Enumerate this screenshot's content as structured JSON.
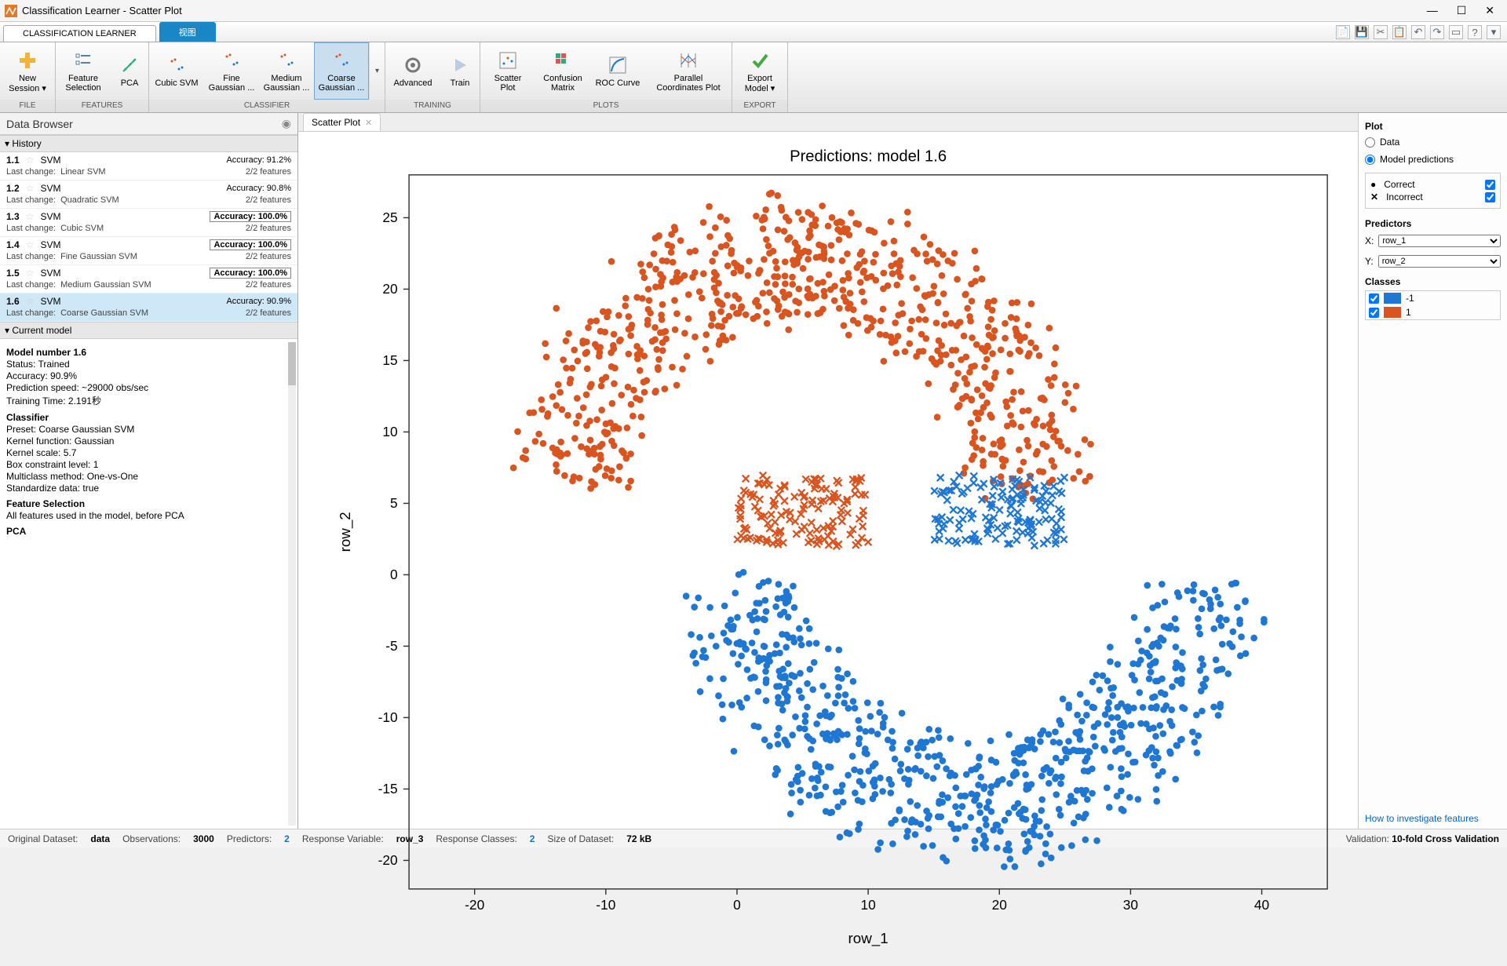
{
  "window": {
    "title": "Classification Learner - Scatter Plot"
  },
  "apptabs": {
    "main": "CLASSIFICATION LEARNER",
    "view": "视图"
  },
  "ribbon": {
    "groups": {
      "file": {
        "label": "FILE",
        "new_session": "New\nSession ▾"
      },
      "features": {
        "label": "FEATURES",
        "feature_selection": "Feature\nSelection",
        "pca": "PCA"
      },
      "classifier": {
        "label": "CLASSIFIER",
        "cubic": "Cubic SVM",
        "fine": "Fine\nGaussian ...",
        "medium": "Medium\nGaussian ...",
        "coarse": "Coarse\nGaussian ..."
      },
      "training": {
        "label": "TRAINING",
        "advanced": "Advanced",
        "train": "Train"
      },
      "plots": {
        "label": "PLOTS",
        "scatter": "Scatter\nPlot",
        "confusion": "Confusion\nMatrix",
        "roc": "ROC Curve",
        "parallel": "Parallel\nCoordinates Plot"
      },
      "export": {
        "label": "EXPORT",
        "export": "Export\nModel ▾"
      }
    }
  },
  "databrowser": {
    "title": "Data Browser",
    "history_label": "▾ History",
    "current_label": "▾ Current model",
    "items": [
      {
        "id": "1.1",
        "type": "SVM",
        "acc": "Accuracy:  91.2%",
        "boxed": false,
        "last": "Linear SVM",
        "features": "2/2 features"
      },
      {
        "id": "1.2",
        "type": "SVM",
        "acc": "Accuracy:  90.8%",
        "boxed": false,
        "last": "Quadratic SVM",
        "features": "2/2 features"
      },
      {
        "id": "1.3",
        "type": "SVM",
        "acc": "Accuracy:  100.0%",
        "boxed": true,
        "last": "Cubic SVM",
        "features": "2/2 features"
      },
      {
        "id": "1.4",
        "type": "SVM",
        "acc": "Accuracy:  100.0%",
        "boxed": true,
        "last": "Fine Gaussian SVM",
        "features": "2/2 features"
      },
      {
        "id": "1.5",
        "type": "SVM",
        "acc": "Accuracy:  100.0%",
        "boxed": true,
        "last": "Medium Gaussian SVM",
        "features": "2/2 features"
      },
      {
        "id": "1.6",
        "type": "SVM",
        "acc": "Accuracy:  90.9%",
        "boxed": false,
        "last": "Coarse Gaussian SVM",
        "features": "2/2 features"
      }
    ],
    "last_change_label": "Last change:",
    "current_model": {
      "l0": "Model number 1.6",
      "l1": "Status: Trained",
      "l2": "Accuracy: 90.9%",
      "l3": "Prediction speed: ~29000 obs/sec",
      "l4": "Training Time: 2.191秒",
      "h1": "Classifier",
      "l5": "Preset: Coarse Gaussian SVM",
      "l6": "Kernel function: Gaussian",
      "l7": "Kernel scale: 5.7",
      "l8": "Box constraint level: 1",
      "l9": "Multiclass method: One-vs-One",
      "l10": "Standardize data: true",
      "h2": "Feature Selection",
      "l11": "All features used in the model, before PCA",
      "h3": "PCA"
    }
  },
  "plot": {
    "tab": "Scatter Plot",
    "title": "Predictions: model 1.6",
    "xlabel": "row_1",
    "ylabel": "row_2"
  },
  "chart_data": {
    "type": "scatter",
    "title": "Predictions: model 1.6",
    "xlabel": "row_1",
    "ylabel": "row_2",
    "xlim": [
      -25,
      45
    ],
    "ylim": [
      -22,
      28
    ],
    "xticks": [
      -20,
      -10,
      0,
      10,
      20,
      30,
      40
    ],
    "yticks": [
      -20,
      -15,
      -10,
      -5,
      0,
      5,
      10,
      15,
      20,
      25
    ],
    "series": [
      {
        "name": "class 1 correct",
        "class": "1",
        "marker": "circle",
        "color": "#d9541e",
        "shape": "upper-arc",
        "count_approx": 900
      },
      {
        "name": "class -1 correct",
        "class": "-1",
        "marker": "circle",
        "color": "#1f77d4",
        "shape": "lower-arc",
        "count_approx": 900
      },
      {
        "name": "class 1 incorrect",
        "class": "1",
        "marker": "x",
        "color": "#d9541e",
        "region": {
          "x": [
            0,
            10
          ],
          "y": [
            2,
            7
          ]
        },
        "count_approx": 140
      },
      {
        "name": "class -1 incorrect",
        "class": "-1",
        "marker": "x",
        "color": "#1f77d4",
        "region": {
          "x": [
            15,
            25
          ],
          "y": [
            2,
            7
          ]
        },
        "count_approx": 140
      }
    ],
    "legend": {
      "correct": "Correct",
      "incorrect": "Incorrect"
    }
  },
  "rightpanel": {
    "plot": "Plot",
    "data": "Data",
    "model_pred": "Model predictions",
    "correct": "Correct",
    "incorrect": "Incorrect",
    "predictors": "Predictors",
    "x": "X:",
    "y": "Y:",
    "x_val": "row_1",
    "y_val": "row_2",
    "classes": "Classes",
    "class_neg": "-1",
    "class_pos": "1",
    "link": "How to investigate features"
  },
  "colors": {
    "orange": "#d9541e",
    "blue": "#1f77d4"
  },
  "status": {
    "orig": "Original Dataset:",
    "orig_v": "data",
    "obs": "Observations:",
    "obs_v": "3000",
    "pred": "Predictors:",
    "pred_v": "2",
    "resp": "Response Variable:",
    "resp_v": "row_3",
    "rclass": "Response Classes:",
    "rclass_v": "2",
    "size": "Size of Dataset:",
    "size_v": "72 kB",
    "valid": "Validation:",
    "valid_v": "10-fold Cross Validation"
  }
}
